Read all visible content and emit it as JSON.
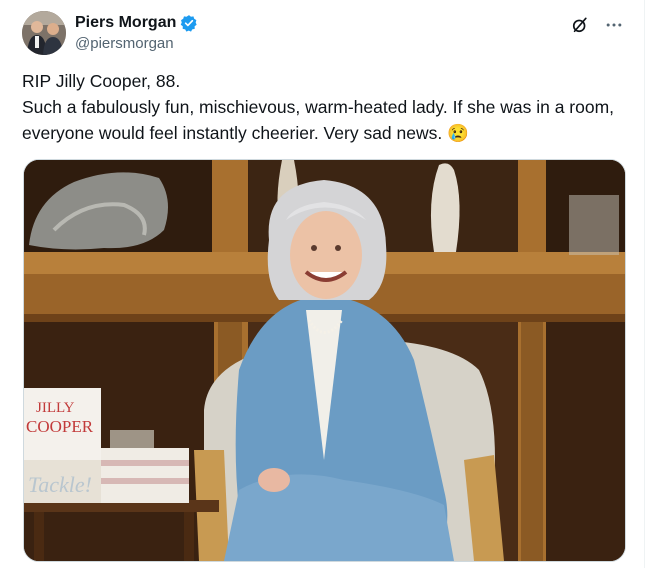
{
  "post": {
    "author_name": "Piers Morgan",
    "author_handle": "@piersmorgan",
    "text_line1": "RIP Jilly Cooper, 88.",
    "text_line2": "Such a fabulously fun, mischievous, warm-heated lady. If she was in a room, everyone would feel instantly cheerier. Very sad news. 😢"
  },
  "icons": {
    "verified": "verified-badge-icon",
    "grok": "grok-icon",
    "more": "more-icon"
  },
  "media": {
    "book_title_line1": "JILLY",
    "book_title_line2": "COOPER",
    "book_title_line3": "Tackle!"
  },
  "colors": {
    "verified_blue": "#1d9bf0",
    "text_primary": "#0f1419",
    "text_secondary": "#536471"
  }
}
